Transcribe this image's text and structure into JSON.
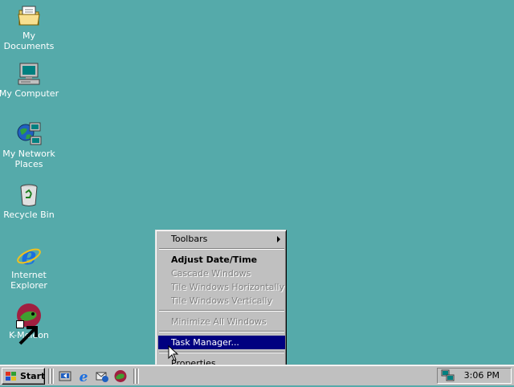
{
  "desktop": {
    "background": "#55aaaa",
    "icons": [
      {
        "label": "My Documents",
        "icon": "folder-documents-icon"
      },
      {
        "label": "My Computer",
        "icon": "computer-icon"
      },
      {
        "label": "My Network Places",
        "icon": "network-places-icon"
      },
      {
        "label": "Recycle Bin",
        "icon": "recycle-bin-icon"
      },
      {
        "label": "Internet Explorer",
        "icon": "internet-explorer-icon"
      },
      {
        "label": "K-Meleon",
        "icon": "k-meleon-icon"
      }
    ]
  },
  "context_menu": {
    "items": [
      {
        "label": "Toolbars",
        "state": "enabled",
        "submenu": true
      },
      {
        "label": "Adjust Date/Time",
        "state": "default"
      },
      {
        "label": "Cascade Windows",
        "state": "disabled"
      },
      {
        "label": "Tile Windows Horizontally",
        "state": "disabled"
      },
      {
        "label": "Tile Windows Vertically",
        "state": "disabled"
      },
      {
        "label": "Minimize All Windows",
        "state": "disabled"
      },
      {
        "label": "Task Manager...",
        "state": "selected"
      },
      {
        "label": "Properties",
        "state": "enabled"
      }
    ],
    "selected_color": "#000080"
  },
  "taskbar": {
    "start_label": "Start",
    "quick_launch": [
      "show-desktop-icon",
      "internet-explorer-icon",
      "outlook-express-icon",
      "k-meleon-icon"
    ],
    "tray": {
      "icon": "network-tray-icon",
      "clock": "3:06 PM"
    }
  }
}
